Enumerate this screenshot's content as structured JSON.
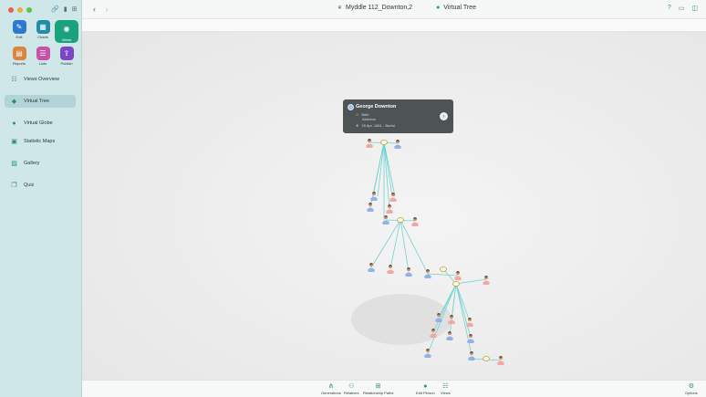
{
  "window": {
    "breadcrumb_file": "Myddle 112_Downton,2",
    "breadcrumb_view": "Virtual Tree"
  },
  "modules": [
    {
      "label": "Edit",
      "icon": "pencil-icon",
      "color": "#2a7bd0"
    },
    {
      "label": "Charts",
      "icon": "charts-grid-icon",
      "color": "#1f8da7"
    },
    {
      "label": "Views",
      "icon": "eye-icon",
      "color": "#1aa17d",
      "active": true
    },
    {
      "label": "Reports",
      "icon": "report-icon",
      "color": "#d9853b"
    },
    {
      "label": "Lists",
      "icon": "list-icon",
      "color": "#c653a8"
    },
    {
      "label": "Publish",
      "icon": "upload-icon",
      "color": "#7b47c3"
    }
  ],
  "sidebar": {
    "items": [
      {
        "label": "Views Overview",
        "icon": "grid-list-icon"
      },
      {
        "label": "Virtual Tree",
        "icon": "cube-icon",
        "active": true
      },
      {
        "label": "Virtual Globe",
        "icon": "globe-icon"
      },
      {
        "label": "Statistic Maps",
        "icon": "map-icon"
      },
      {
        "label": "Gallery",
        "icon": "gallery-icon"
      },
      {
        "label": "Quiz",
        "icon": "quiz-icon"
      }
    ]
  },
  "popup": {
    "name": "George Downton",
    "birth_label": "Birth",
    "birth_place": "Alderton",
    "burial": "25 Apr. 1661 - Burial"
  },
  "bottom_bar": {
    "generations": "Generations",
    "relatives": "Relatives",
    "relationship_paths": "Relationship Paths",
    "edit_person": "Edit Person",
    "views": "Views",
    "options": "Options"
  },
  "colors": {
    "accent": "#1aa17d",
    "sidebar_bg": "#cfe7e9",
    "tree_lines": "#6fd3cf",
    "male_figure": "#8fb3e6",
    "female_figure": "#f0a8a0"
  }
}
